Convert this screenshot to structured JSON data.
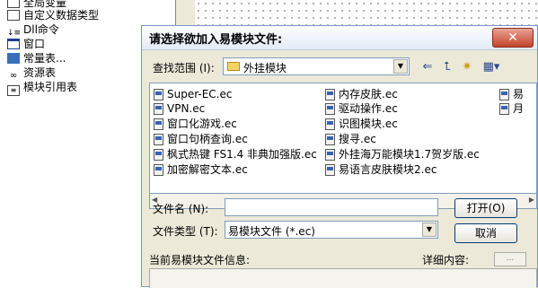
{
  "tree": {
    "items": [
      {
        "label": "全局变量",
        "icon": "globals-icon"
      },
      {
        "label": "自定义数据类型",
        "icon": "datatype-icon"
      },
      {
        "label": "Dll命令",
        "icon": "dll-icon"
      },
      {
        "label": "窗口",
        "icon": "window-icon"
      },
      {
        "label": "常量表...",
        "icon": "constants-icon"
      },
      {
        "label": "资源表",
        "icon": "resources-icon"
      },
      {
        "label": "模块引用表",
        "icon": "modules-icon"
      }
    ]
  },
  "dialog": {
    "title": "请选择欲加入易模块文件:",
    "close_label": "✕",
    "lookin_label": "查找范围 (I):",
    "lookin_value": "外挂模块",
    "files_col1": [
      "Super-EC.ec",
      "VPN.ec",
      "窗口化游戏.ec",
      "窗口句柄查询.ec",
      "枫式热键 FS1.4 非典加强版.ec",
      "加密解密文本.ec"
    ],
    "files_col2": [
      "内存皮肤.ec",
      "驱动操作.ec",
      "识图模块.ec",
      "搜寻.ec",
      "外挂海万能模块1.7贺岁版.ec",
      "易语言皮肤模块2.ec"
    ],
    "files_col3": [
      "易",
      "月"
    ],
    "filename_label": "文件名 (N):",
    "filename_value": "",
    "filetype_label": "文件类型 (T):",
    "filetype_value": "易模块文件 (*.ec)",
    "open_label": "打开(O)",
    "cancel_label": "取消",
    "info_label": "当前易模块文件信息:",
    "detail_label": "详细内容:",
    "detail_button": "..."
  }
}
